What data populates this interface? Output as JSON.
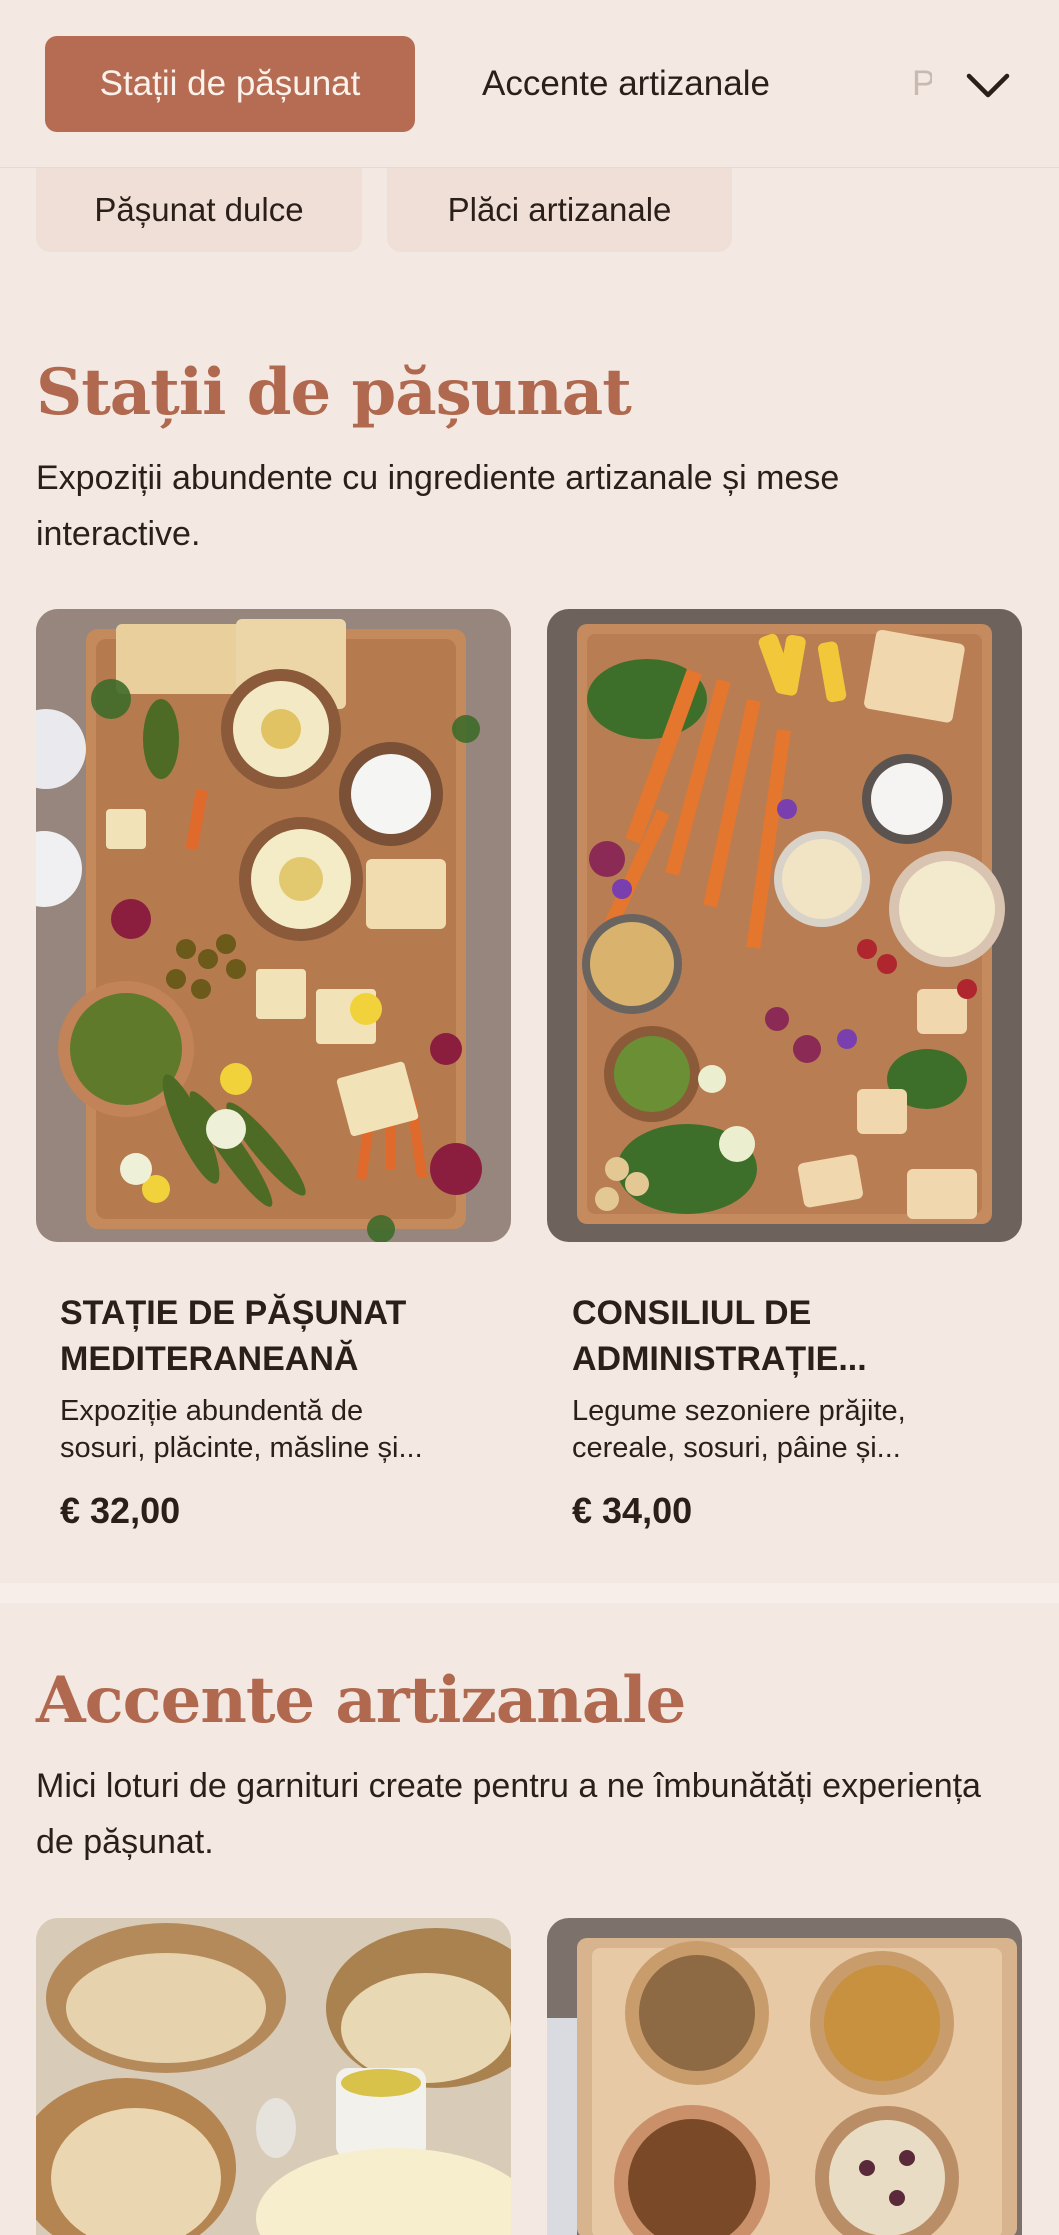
{
  "nav": {
    "tabs": [
      {
        "label": "Stații de pășunat",
        "active": true
      },
      {
        "label": "Accente artizanale",
        "active": false
      },
      {
        "label": "P",
        "active": false
      }
    ],
    "expand_icon": "chevron-down-icon",
    "subtabs": [
      {
        "label": "Pășunat dulce"
      },
      {
        "label": "Plăci artizanale"
      }
    ]
  },
  "sections": [
    {
      "title": "Stații de pășunat",
      "description": "Expoziții abundente cu ingrediente artizanale și mese interactive.",
      "products": [
        {
          "title_line1": "STAȚIE DE PĂȘUNAT",
          "title_line2": "MEDITERANEANĂ",
          "desc_line1": "Expoziție abundentă de",
          "desc_line2": "sosuri, plăcinte, măsline și...",
          "price": "€ 32,00"
        },
        {
          "title_line1": "CONSILIUL DE",
          "title_line2": "ADMINISTRAȚIE...",
          "desc_line1": "Legume sezoniere prăjite,",
          "desc_line2": "cereale, sosuri, pâine și...",
          "price": "€ 34,00"
        }
      ]
    },
    {
      "title": "Accente artizanale",
      "description": "Mici loturi de garnituri create pentru a ne îmbunătăți experiența de pășunat.",
      "products": []
    }
  ],
  "colors": {
    "background": "#f3e8e2",
    "accent": "#b66c52",
    "heading": "#b0684e",
    "text": "#2b1f1a"
  }
}
